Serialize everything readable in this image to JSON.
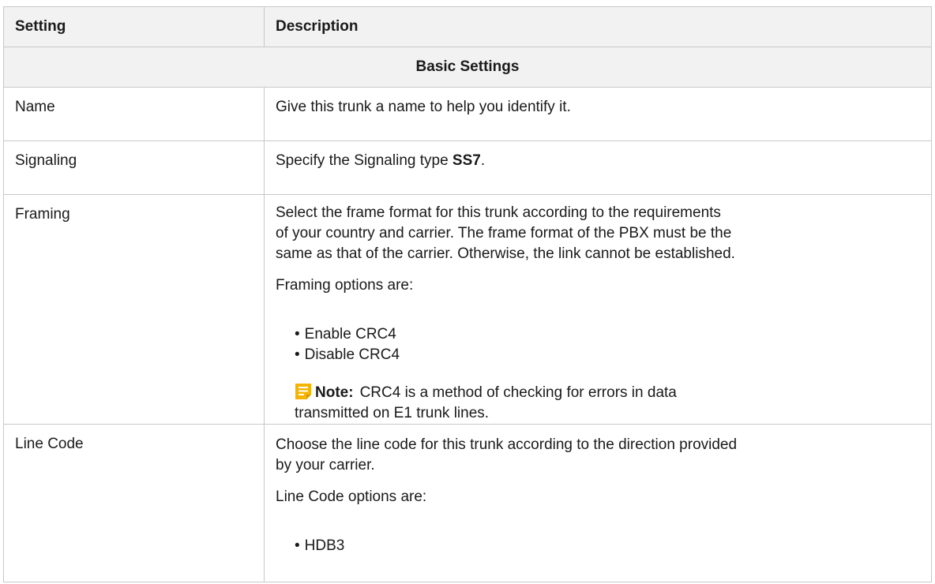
{
  "table": {
    "headers": {
      "setting": "Setting",
      "description": "Description"
    },
    "section_title": "Basic Settings",
    "rows": {
      "name": {
        "setting": "Name",
        "description": "Give this trunk a name to help you identify it."
      },
      "signaling": {
        "setting": "Signaling",
        "description_prefix": "Specify the Signaling type ",
        "description_bold": "SS7",
        "description_suffix": "."
      },
      "framing": {
        "setting": "Framing",
        "description_lines": [
          "Select the frame format for this trunk according to the requirements",
          "of your country and carrier. The frame format of the PBX must be the",
          "same as that of the carrier. Otherwise, the link cannot be established."
        ],
        "options_intro": "Framing options are:",
        "options": [
          "Enable CRC4",
          "Disable CRC4"
        ],
        "note_label": "Note:",
        "note_lines": [
          "CRC4 is a method of checking for errors in data",
          "transmitted on E1 trunk lines."
        ]
      },
      "line_code": {
        "setting": "Line Code",
        "description_lines": [
          "Choose the line code for this trunk according to the direction provided",
          "by your carrier."
        ],
        "options_intro": "Line Code options are:",
        "options": [
          "HDB3"
        ]
      }
    }
  },
  "colors": {
    "header_bg": "#f2f2f2",
    "border": "#c8c8c8",
    "note_icon": "#f5b400"
  },
  "icons": {
    "note": "note-icon"
  }
}
